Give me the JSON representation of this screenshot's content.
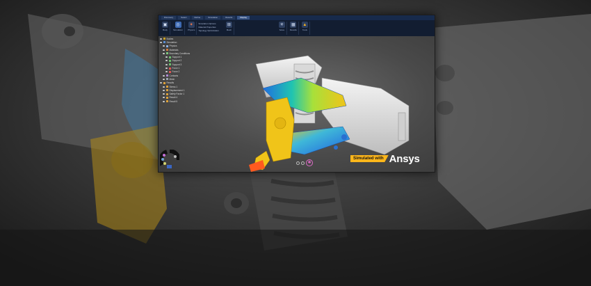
{
  "tabs": [
    {
      "label": "Discovery",
      "active": false
    },
    {
      "label": "Select",
      "active": false
    },
    {
      "label": "Refine",
      "active": false
    },
    {
      "label": "Simulation",
      "active": false
    },
    {
      "label": "Results",
      "active": false
    },
    {
      "label": "Display",
      "active": true
    }
  ],
  "ribbon": {
    "groups": [
      {
        "label": "Body",
        "icon": "body-icon"
      },
      {
        "label": "Simulation",
        "icon": "simulation-icon",
        "active": true
      },
      {
        "label": "Physics",
        "icon": "physics-icon"
      },
      {
        "label": "Mesh",
        "icon": "mesh-icon"
      },
      {
        "label": "Solve",
        "icon": "solve-icon"
      },
      {
        "label": "Results",
        "icon": "results-icon"
      },
      {
        "label": "Tools",
        "icon": "tools-icon"
      }
    ],
    "list_items": [
      "Simulation Options",
      "Material Properties",
      "Topology Optimization"
    ]
  },
  "tree": [
    {
      "label": "Bodies",
      "indent": 0,
      "color": "#c9a227"
    },
    {
      "label": "Simulation",
      "indent": 0,
      "color": "#5a8fd6"
    },
    {
      "label": "Physics",
      "indent": 1,
      "color": "#8fb3e6"
    },
    {
      "label": "Materials",
      "indent": 1,
      "color": "#d67a3a"
    },
    {
      "label": "Boundary Conditions",
      "indent": 1,
      "color": "#7fc97f"
    },
    {
      "label": "Support 1",
      "indent": 2,
      "color": "#6ec16e"
    },
    {
      "label": "Support 2",
      "indent": 2,
      "color": "#6ec16e"
    },
    {
      "label": "Support 3",
      "indent": 2,
      "color": "#6ec16e"
    },
    {
      "label": "Force 1",
      "indent": 2,
      "color": "#e05555"
    },
    {
      "label": "Force 2",
      "indent": 2,
      "color": "#e05555"
    },
    {
      "label": "Contacts",
      "indent": 1,
      "color": "#b38bd6"
    },
    {
      "label": "Mesh",
      "indent": 1,
      "color": "#9ea7b0"
    },
    {
      "label": "Results",
      "indent": 0,
      "color": "#e0a33a"
    },
    {
      "label": "Stress 1",
      "indent": 1,
      "color": "#e0a33a"
    },
    {
      "label": "Displacement 1",
      "indent": 1,
      "color": "#e0a33a"
    },
    {
      "label": "Safety Factor 1",
      "indent": 1,
      "color": "#e0a33a"
    },
    {
      "label": "Result 4",
      "indent": 1,
      "color": "#e0a33a"
    },
    {
      "label": "Result 5",
      "indent": 1,
      "color": "#e0a33a"
    }
  ],
  "badge": {
    "label": "Simulated with",
    "brand": "Ansys"
  }
}
